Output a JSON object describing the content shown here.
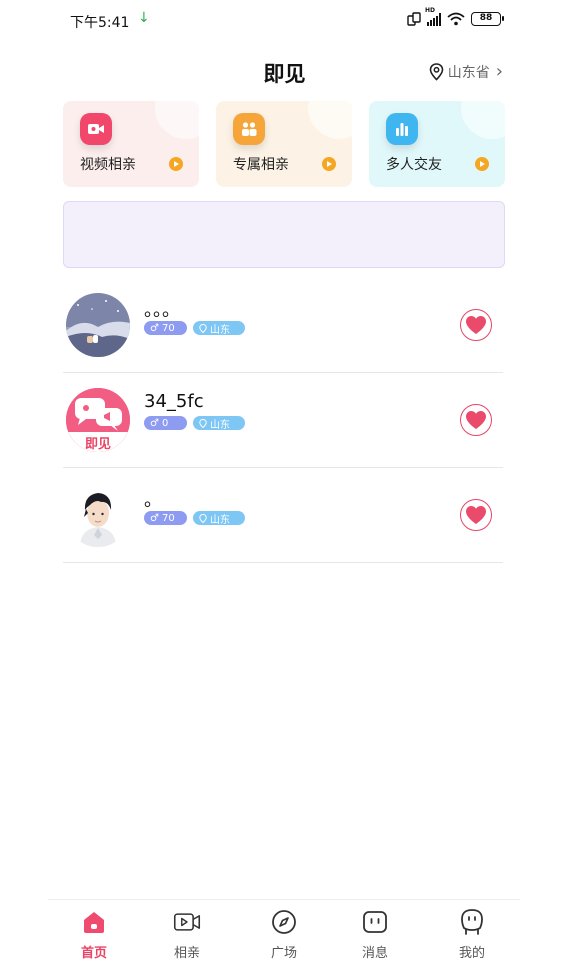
{
  "status_bar": {
    "time": "下午5:41",
    "download_arrow": "↓",
    "hd_label": "HD",
    "battery": "88"
  },
  "header": {
    "title": "即见",
    "location": "山东省",
    "location_chevron": "›"
  },
  "feature_cards": [
    {
      "label": "视频相亲",
      "icon": "video-camera-icon",
      "bg": "#fdeeee",
      "accent": "#f0476a"
    },
    {
      "label": "专属相亲",
      "icon": "couple-icon",
      "bg": "#fcf3e6",
      "accent": "#f6a53a"
    },
    {
      "label": "多人交友",
      "icon": "bar-chart-icon",
      "bg": "#e1f8fb",
      "accent": "#3fb6f0"
    }
  ],
  "users": [
    {
      "name": "。。。",
      "gender_symbol": "♂",
      "age": "70",
      "location": "山东",
      "avatar": "landscape-avatar"
    },
    {
      "name": "34_5fc",
      "gender_symbol": "♂",
      "age": "0",
      "location": "山东",
      "avatar": "app-logo-avatar",
      "avatar_text": "即见"
    },
    {
      "name": "。",
      "gender_symbol": "♂",
      "age": "70",
      "location": "山东",
      "avatar": "boy-illustration-avatar"
    }
  ],
  "bottom_nav": [
    {
      "label": "首页",
      "icon": "home-icon",
      "active": true
    },
    {
      "label": "相亲",
      "icon": "video-icon",
      "active": false
    },
    {
      "label": "广场",
      "icon": "compass-icon",
      "active": false
    },
    {
      "label": "消息",
      "icon": "message-icon",
      "active": false
    },
    {
      "label": "我的",
      "icon": "profile-icon",
      "active": false
    }
  ],
  "colors": {
    "accent": "#e94466",
    "gender_tag": "#8d9bf1",
    "location_tag": "#7ec7f5",
    "banner_bg": "#f4f0fb"
  }
}
